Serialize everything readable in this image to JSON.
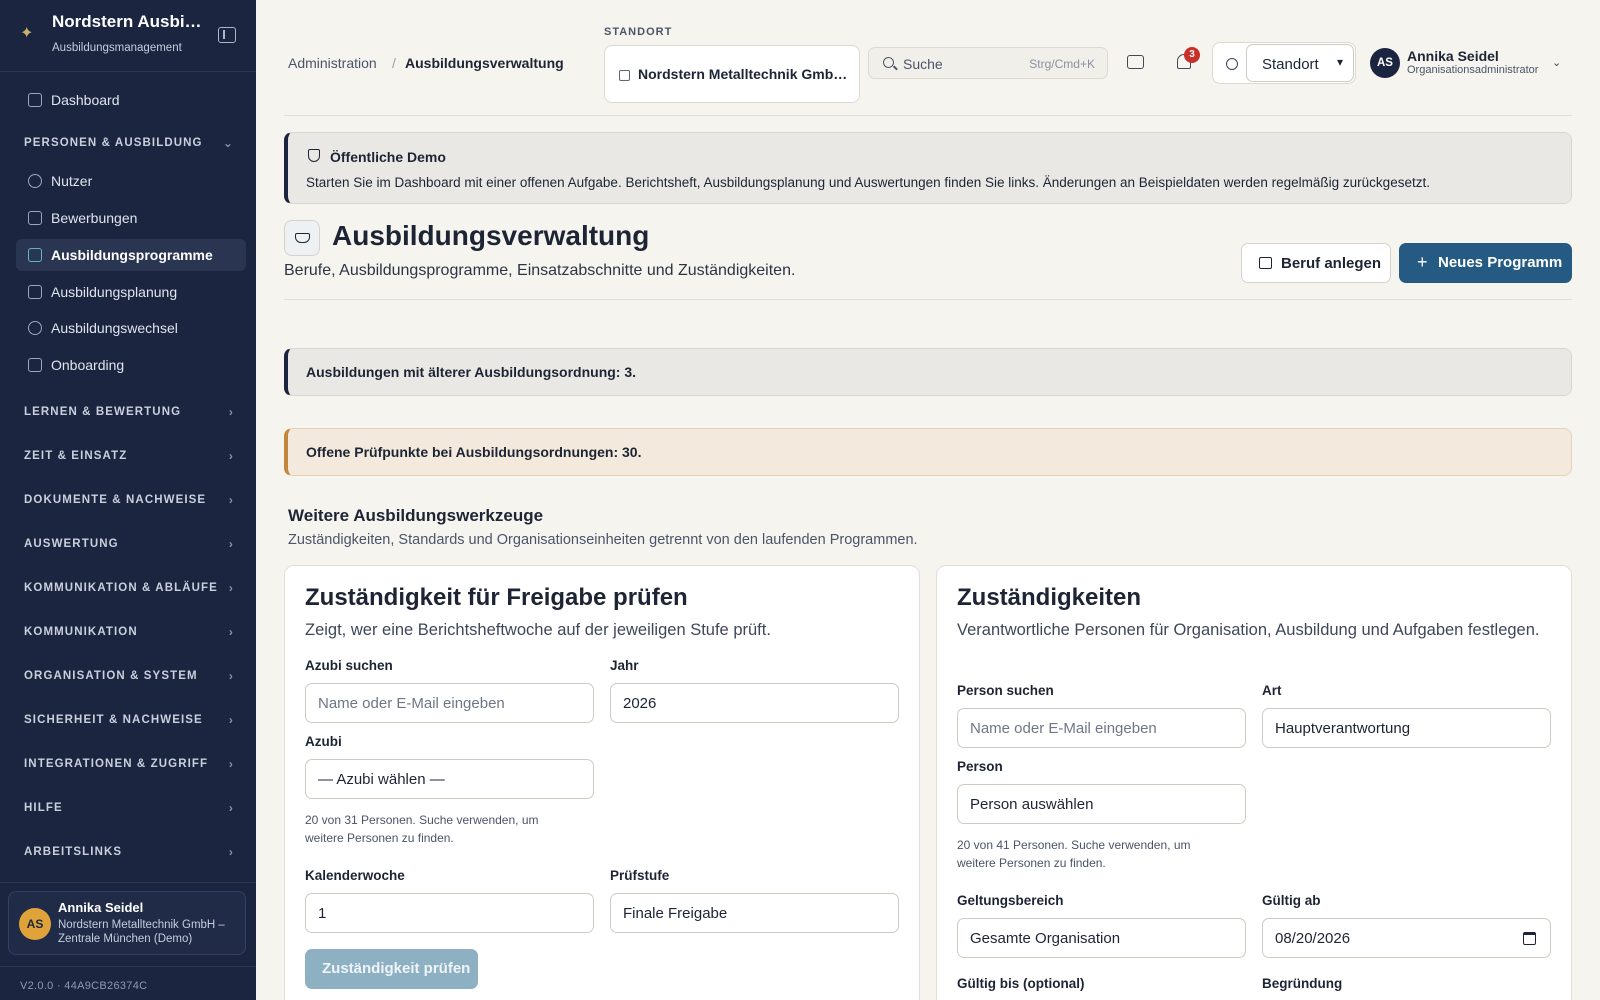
{
  "sidebar": {
    "brand_name": "Nordstern Ausbildung",
    "brand_sub": "Ausbildungsmanagement",
    "items": [
      {
        "label": "Dashboard"
      },
      {
        "label": "Nutzer"
      },
      {
        "label": "Bewerbungen"
      },
      {
        "label": "Ausbildungsprogramme"
      },
      {
        "label": "Ausbildungsplanung"
      },
      {
        "label": "Ausbildungswechsel"
      },
      {
        "label": "Onboarding"
      }
    ],
    "groups": [
      {
        "label": "PERSONEN & AUSBILDUNG",
        "expanded": true
      },
      {
        "label": "LERNEN & BEWERTUNG"
      },
      {
        "label": "ZEIT & EINSATZ"
      },
      {
        "label": "DOKUMENTE & NACHWEISE"
      },
      {
        "label": "AUSWERTUNG"
      },
      {
        "label": "KOMMUNIKATION & ABLÄUFE"
      },
      {
        "label": "KOMMUNIKATION"
      },
      {
        "label": "ORGANISATION & SYSTEM"
      },
      {
        "label": "SICHERHEIT & NACHWEISE"
      },
      {
        "label": "INTEGRATIONEN & ZUGRIFF"
      },
      {
        "label": "HILFE"
      },
      {
        "label": "ARBEITSLINKS"
      }
    ],
    "user": {
      "initials": "AS",
      "name": "Annika Seidel",
      "org": "Nordstern Metalltechnik GmbH – Zentrale München (Demo)"
    },
    "version": "V2.0.0 · 44A9CB26374C"
  },
  "topbar": {
    "breadcrumb": [
      "Administration",
      "/",
      "Ausbildungsverwaltung"
    ],
    "site_label": "STANDORT",
    "site_value": "Nordstern Metalltechnik GmbH – Zentrale München",
    "search_placeholder": "Suche",
    "search_shortcut": "Strg/Cmd+K",
    "notification_count": "3",
    "theme_select": "Standort",
    "user_initials": "AS",
    "user_name": "Annika Seidel",
    "user_role": "Organisationsadministrator"
  },
  "alerts": {
    "demo_title": "Öffentliche Demo",
    "demo_body": "Starten Sie im Dashboard mit einer offenen Aufgabe. Berichtsheft, Ausbildungsplanung und Auswertungen finden Sie links. Änderungen an Beispieldaten werden regelmäßig zurückgesetzt.",
    "info": "Ausbildungen mit älterer Ausbildungsordnung: 3.",
    "warn": "Offene Prüfpunkte bei Ausbildungsordnungen: 30."
  },
  "page": {
    "title": "Ausbildungsverwaltung",
    "subtitle": "Berufe, Ausbildungsprogramme, Einsatzabschnitte und Zuständigkeiten.",
    "btn_beruf": "Beruf anlegen",
    "btn_programm": "Neues Programm"
  },
  "section": {
    "title": "Weitere Ausbildungswerkzeuge",
    "subtitle": "Zuständigkeiten, Standards und Organisationseinheiten getrennt von den laufenden Programmen."
  },
  "card_left": {
    "title": "Zuständigkeit für Freigabe prüfen",
    "desc": "Zeigt, wer eine Berichtsheftwoche auf der jeweiligen Stufe prüft.",
    "azubi_search_label": "Azubi suchen",
    "azubi_search_placeholder": "Name oder E-Mail eingeben",
    "year_label": "Jahr",
    "year_value": "2026",
    "azubi_label": "Azubi",
    "azubi_value": "— Azubi wählen —",
    "hint": "20 von 31 Personen. Suche verwenden, um weitere Personen zu finden.",
    "week_label": "Kalenderwoche",
    "week_value": "1",
    "level_label": "Prüfstufe",
    "level_value": "Finale Freigabe",
    "submit": "Zuständigkeit prüfen"
  },
  "card_right": {
    "title": "Zuständigkeiten",
    "desc": "Verantwortliche Personen für Organisation, Ausbildung und Aufgaben festlegen.",
    "person_search_label": "Person suchen",
    "person_search_placeholder": "Name oder E-Mail eingeben",
    "type_label": "Art",
    "type_value": "Hauptverantwortung",
    "person_label": "Person",
    "person_value": "Person auswählen",
    "hint": "20 von 41 Personen. Suche verwenden, um weitere Personen zu finden.",
    "scope_label": "Geltungsbereich",
    "scope_value": "Gesamte Organisation",
    "valid_from_label": "Gültig ab",
    "valid_from_value": "08/20/2026",
    "valid_to_label": "Gültig bis (optional)",
    "reason_label": "Begründung"
  }
}
